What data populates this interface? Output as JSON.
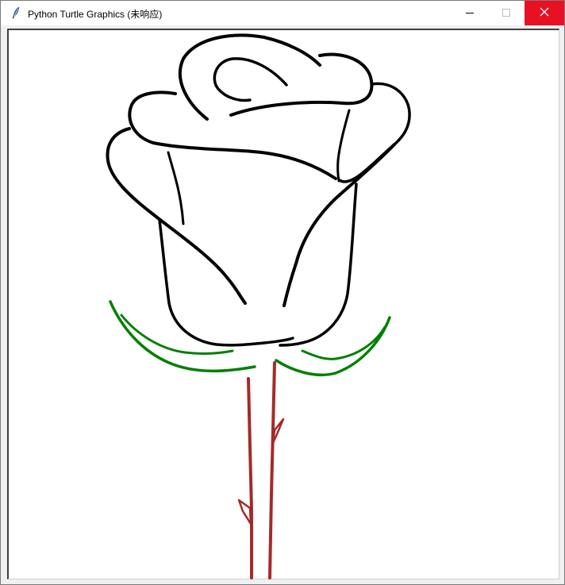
{
  "window": {
    "title": "Python Turtle Graphics (未响应)"
  },
  "icons": {
    "app": "feather-icon",
    "minimize": "minimize-icon",
    "maximize": "maximize-icon",
    "close": "close-icon"
  },
  "colors": {
    "close_button": "#e81123",
    "petal_outline": "#000000",
    "leaves": "#008000",
    "stem": "#a52a2a"
  }
}
